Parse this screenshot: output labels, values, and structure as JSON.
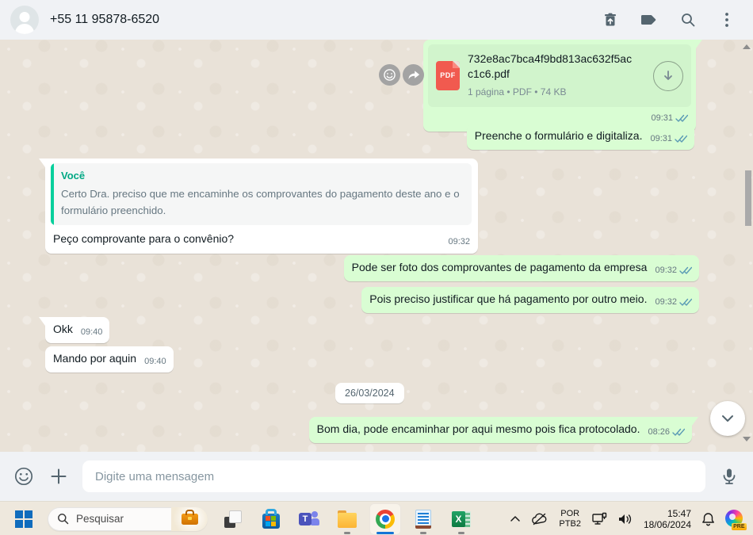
{
  "header": {
    "contact_title": "+55 11 95878-6520",
    "action_icons": [
      "trash-delete",
      "label-tag",
      "search",
      "kebab-menu"
    ]
  },
  "chat": {
    "date_divider": "26/03/2024",
    "hover_action_icons": [
      "emoji-react",
      "forward"
    ],
    "messages": [
      {
        "direction": "out",
        "type": "file",
        "file_name": "732e8ac7bca4f9bd813ac632f5acc1c6.pdf",
        "file_meta": "1 página • PDF • 74 KB",
        "time": "09:31",
        "status": "read"
      },
      {
        "direction": "out",
        "type": "text",
        "text": "Preenche o formulário e digitaliza.",
        "time": "09:31",
        "status": "read"
      },
      {
        "direction": "in",
        "type": "text",
        "quote": {
          "author": "Você",
          "text": "Certo Dra. preciso que me encaminhe os comprovantes do pagamento deste ano e o formulário preenchido."
        },
        "text": "Peço comprovante para o convênio?",
        "time": "09:32"
      },
      {
        "direction": "out",
        "type": "text",
        "text": "Pode ser foto dos comprovantes de pagamento da empresa",
        "time": "09:32",
        "status": "read"
      },
      {
        "direction": "out",
        "type": "text",
        "text": "Pois preciso justificar que há pagamento por outro meio.",
        "time": "09:32",
        "status": "read"
      },
      {
        "direction": "in",
        "type": "text",
        "text": "Okk",
        "time": "09:40"
      },
      {
        "direction": "in",
        "type": "text",
        "text": "Mando por aquin",
        "time": "09:40"
      },
      {
        "direction": "out",
        "type": "text",
        "text": "Bom dia, pode encaminhar por aqui mesmo pois fica protocolado.",
        "time": "08:26",
        "status": "read"
      }
    ],
    "pdf_badge_label": "PDF"
  },
  "composer": {
    "placeholder": "Digite uma mensagem",
    "icons": [
      "emoji",
      "attach-plus",
      "microphone"
    ]
  },
  "taskbar": {
    "search_placeholder": "Pesquisar",
    "apps": [
      "task-view",
      "microsoft-store",
      "teams",
      "file-explorer",
      "chrome",
      "notepad",
      "excel"
    ],
    "tray": {
      "language_line1": "POR",
      "language_line2": "PTB2",
      "clock_time": "15:47",
      "clock_date": "18/06/2024",
      "copilot_badge": "PRE",
      "icons": [
        "chevron-up",
        "onedrive-offline-cloud",
        "ethernet",
        "volume",
        "bell",
        "copilot"
      ]
    }
  },
  "colors": {
    "outgoing_bubble": "#d9fdd3",
    "incoming_bubble": "#ffffff",
    "accent_green": "#06cf9c",
    "read_tick": "#5b9bb5",
    "slate_icon": "#54656f",
    "taskbar_bg": "#eee8dd"
  }
}
